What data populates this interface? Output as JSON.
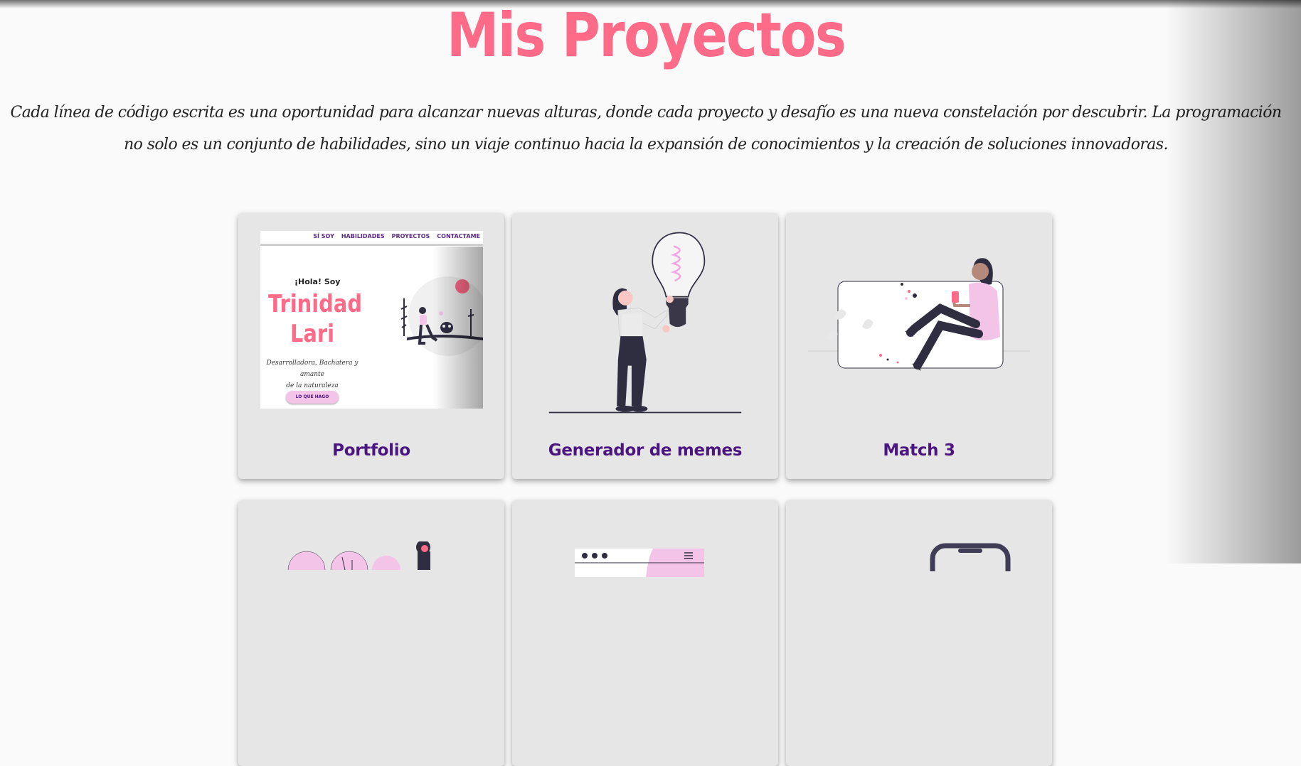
{
  "page": {
    "title": "Mis Proyectos",
    "intro": "Cada línea de código escrita es una oportunidad para alcanzar nuevas alturas, donde cada proyecto y desafío es una nueva constelación por descubrir. La programación no solo es un conjunto de habilidades, sino un viaje continuo hacia la expansión de conocimientos y la creación de soluciones innovadoras."
  },
  "colors": {
    "accent": "#fe6b89",
    "title_purple": "#4b1680",
    "card_bg": "#e6e6e6",
    "pink_light": "#f4c3e8",
    "dark": "#2f2e41"
  },
  "projects": [
    {
      "title": "Portfolio",
      "image": "portfolio-screenshot"
    },
    {
      "title": "Generador de memes",
      "image": "lightbulb-illustration"
    },
    {
      "title": "Match 3",
      "image": "phone-user-illustration"
    },
    {
      "title": "",
      "image": "analytics-illustration"
    },
    {
      "title": "",
      "image": "browser-window-illustration"
    },
    {
      "title": "",
      "image": "smartphone-illustration"
    }
  ],
  "portfolio_preview": {
    "nav": [
      "SÍ SOY",
      "HABILIDADES",
      "PROYECTOS",
      "CONTACTAME"
    ],
    "greeting": "¡Hola! Soy",
    "name_line1": "Trinidad",
    "name_line2": "Lari",
    "description_line1": "Desarrolladora, Bachatera y amante",
    "description_line2": "de la naturaleza",
    "button": "LO QUE HAGO"
  }
}
